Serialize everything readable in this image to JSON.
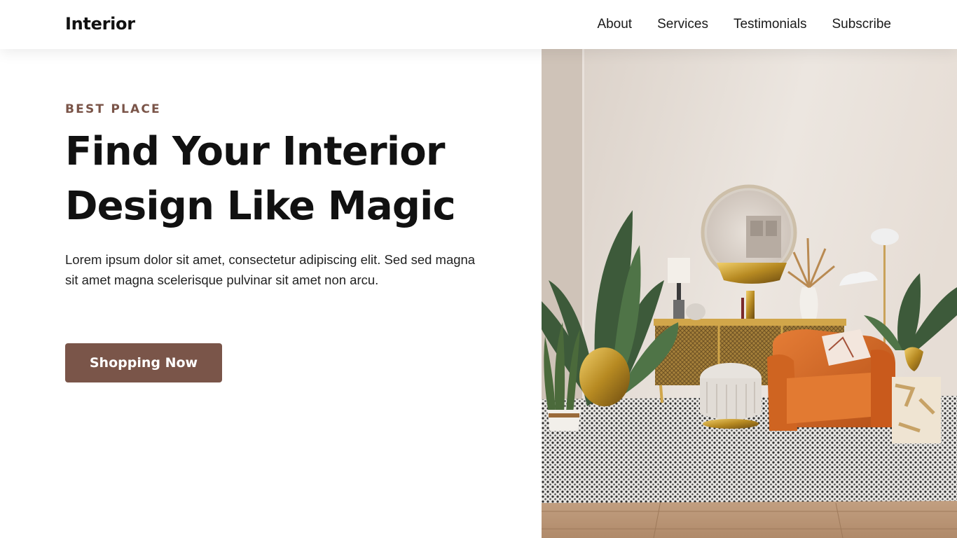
{
  "header": {
    "brand": "Interior",
    "nav": [
      {
        "label": "About"
      },
      {
        "label": "Services"
      },
      {
        "label": "Testimonials"
      },
      {
        "label": "Subscribe"
      }
    ]
  },
  "hero": {
    "eyebrow": "BEST PLACE",
    "headline_line1": "Find Your Interior",
    "headline_line2": "Design Like Magic",
    "lead": "Lorem ipsum dolor sit amet, consectetur adipiscing elit. Sed sed magna sit amet magna scelerisque pulvinar sit amet non arcu.",
    "cta_label": "Shopping Now"
  },
  "colors": {
    "accent": "#7a5549",
    "eyebrow": "#7a5448",
    "text": "#111111",
    "background": "#ffffff"
  }
}
